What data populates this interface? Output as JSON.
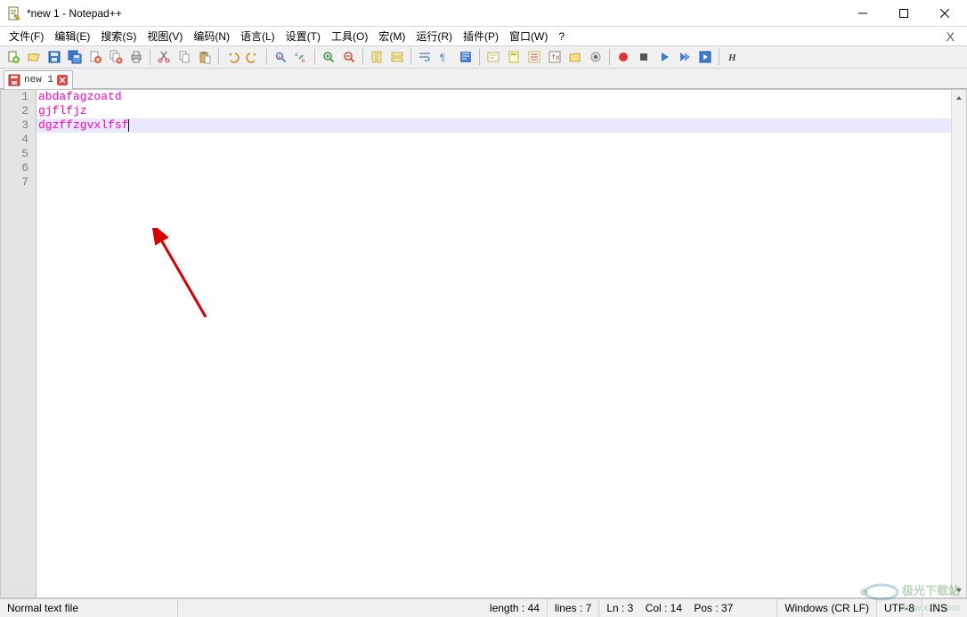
{
  "window": {
    "title": "*new 1 - Notepad++"
  },
  "menu": {
    "items": [
      "文件(F)",
      "编辑(E)",
      "搜索(S)",
      "视图(V)",
      "编码(N)",
      "语言(L)",
      "设置(T)",
      "工具(O)",
      "宏(M)",
      "运行(R)",
      "插件(P)",
      "窗口(W)",
      "?"
    ]
  },
  "toolbar_icons": {
    "new": "new-file-icon",
    "open": "open-folder-icon",
    "save": "save-icon",
    "save_all": "save-all-icon",
    "close": "close-file-icon",
    "close_all": "close-all-icon",
    "print": "print-icon",
    "cut": "cut-icon",
    "copy": "copy-icon",
    "paste": "paste-icon",
    "undo": "undo-icon",
    "redo": "redo-icon",
    "find": "find-icon",
    "replace": "replace-icon",
    "zoom_in": "zoom-in-icon",
    "zoom_out": "zoom-out-icon",
    "sync_v": "sync-vscroll-icon",
    "sync_h": "sync-hscroll-icon",
    "wordwrap": "wordwrap-icon",
    "allchars": "show-all-chars-icon",
    "indent": "indent-guide-icon",
    "lang": "user-lang-icon",
    "doc_map": "doc-map-icon",
    "doc_list": "doc-list-icon",
    "func_list": "func-list-icon",
    "folder": "folder-workspace-icon",
    "monitor": "monitor-icon",
    "rec": "record-macro-icon",
    "stop": "stop-macro-icon",
    "play": "play-macro-icon",
    "play_multi": "play-multi-icon",
    "save_macro": "save-macro-icon",
    "hide": "hide-lines-icon"
  },
  "tabs": [
    {
      "label": "new 1",
      "unsaved": true
    }
  ],
  "editor": {
    "lines": [
      "abdafagzoatd",
      "gjflfjz",
      "dgzffzgvxlfsf",
      "",
      "",
      "",
      ""
    ],
    "current_line_index": 2
  },
  "status": {
    "file_type": "Normal text file",
    "length_label": "length : 44",
    "lines_label": "lines : 7",
    "pos_label": "Ln : 3    Col : 14    Pos : 37",
    "eol": "Windows (CR LF)",
    "enc": "UTF-8",
    "ins": "INS"
  },
  "watermark": {
    "main": "极光下载站",
    "url": "www.xz7.com"
  }
}
